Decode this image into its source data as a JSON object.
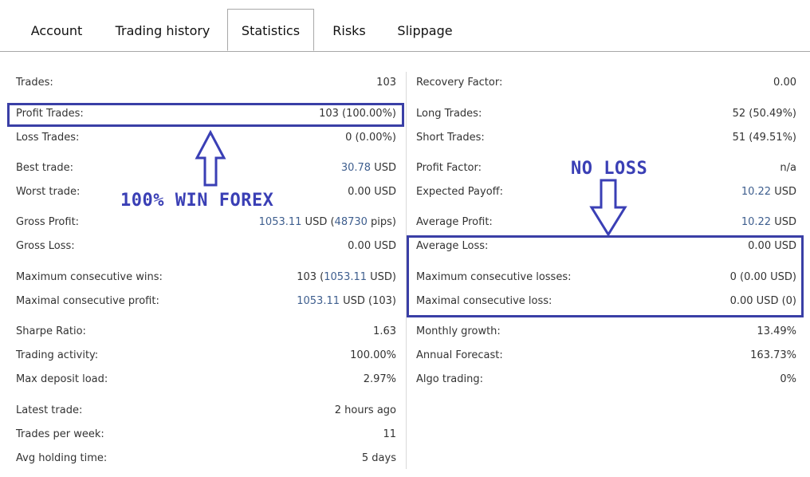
{
  "tabs": [
    {
      "label": "Account"
    },
    {
      "label": "Trading history"
    },
    {
      "label": "Statistics"
    },
    {
      "label": "Risks"
    },
    {
      "label": "Slippage"
    }
  ],
  "left": {
    "trades": {
      "label": "Trades:",
      "value": "103"
    },
    "profit_trades": {
      "label": "Profit Trades:",
      "value": "103 (100.00%)"
    },
    "loss_trades": {
      "label": "Loss Trades:",
      "value": "0 (0.00%)"
    },
    "best_trade": {
      "label": "Best trade:",
      "num": "30.78",
      "unit": " USD"
    },
    "worst_trade": {
      "label": "Worst trade:",
      "value": "0.00 USD"
    },
    "gross_profit": {
      "label": "Gross Profit:",
      "num": "1053.11",
      "mid": " USD (",
      "pips": "48730",
      "end": " pips)"
    },
    "gross_loss": {
      "label": "Gross Loss:",
      "value": "0.00 USD"
    },
    "max_consec_wins": {
      "label": "Maximum consecutive wins:",
      "pre": "103 (",
      "num": "1053.11",
      "end": " USD)"
    },
    "max_consec_profit": {
      "label": "Maximal consecutive profit:",
      "num": "1053.11",
      "end": " USD (103)"
    },
    "sharpe": {
      "label": "Sharpe Ratio:",
      "value": "1.63"
    },
    "activity": {
      "label": "Trading activity:",
      "value": "100.00%"
    },
    "deposit_load": {
      "label": "Max deposit load:",
      "value": "2.97%"
    },
    "latest_trade": {
      "label": "Latest trade:",
      "value": "2 hours ago"
    },
    "per_week": {
      "label": "Trades per week:",
      "value": "11"
    },
    "holding": {
      "label": "Avg holding time:",
      "value": "5 days"
    }
  },
  "right": {
    "recovery": {
      "label": "Recovery Factor:",
      "value": "0.00"
    },
    "long_trades": {
      "label": "Long Trades:",
      "value": "52 (50.49%)"
    },
    "short_trades": {
      "label": "Short Trades:",
      "value": "51 (49.51%)"
    },
    "profit_factor": {
      "label": "Profit Factor:",
      "value": "n/a"
    },
    "expected_payoff": {
      "label": "Expected Payoff:",
      "num": "10.22",
      "unit": " USD"
    },
    "avg_profit": {
      "label": "Average Profit:",
      "num": "10.22",
      "unit": " USD"
    },
    "avg_loss": {
      "label": "Average Loss:",
      "value": "0.00 USD"
    },
    "max_consec_losses": {
      "label": "Maximum consecutive losses:",
      "value": "0 (0.00 USD)"
    },
    "max_consec_loss": {
      "label": "Maximal consecutive loss:",
      "value": "0.00 USD (0)"
    },
    "monthly_growth": {
      "label": "Monthly growth:",
      "value": "13.49%"
    },
    "annual_forecast": {
      "label": "Annual Forecast:",
      "value": "163.73%"
    },
    "algo": {
      "label": "Algo trading:",
      "value": "0%"
    }
  },
  "annotations": {
    "win_text": "100% WIN FOREX",
    "loss_text": "NO LOSS"
  },
  "colors": {
    "accent_link": "#3e5e8e",
    "annotation": "#3a3fb5",
    "tab_border": "#a8a8a8"
  }
}
